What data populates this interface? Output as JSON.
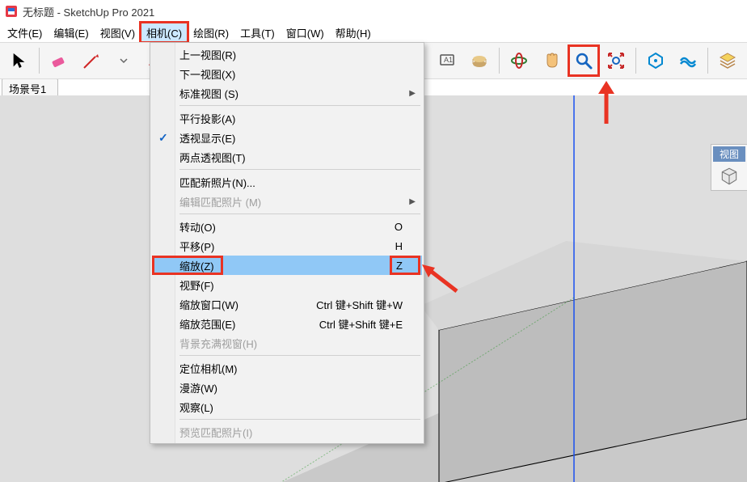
{
  "title": "无标题 - SketchUp Pro 2021",
  "menubar": {
    "file": "文件(E)",
    "edit": "编辑(E)",
    "view": "视图(V)",
    "camera": "相机(C)",
    "draw": "绘图(R)",
    "tools": "工具(T)",
    "window": "窗口(W)",
    "help": "帮助(H)"
  },
  "scene_tab": "场景号1",
  "camera_menu": {
    "prev_view": {
      "label": "上一视图(R)"
    },
    "next_view": {
      "label": "下一视图(X)"
    },
    "standard_views": {
      "label": "标准视图 (S)",
      "submenu": true
    },
    "parallel": {
      "label": "平行投影(A)"
    },
    "perspective": {
      "label": "透视显示(E)",
      "checked": true
    },
    "two_point": {
      "label": "两点透视图(T)"
    },
    "match_new_photo": {
      "label": "匹配新照片(N)..."
    },
    "edit_match_photo": {
      "label": "编辑匹配照片 (M)",
      "submenu": true,
      "disabled": true
    },
    "orbit": {
      "label": "转动(O)",
      "shortcut": "O"
    },
    "pan": {
      "label": "平移(P)",
      "shortcut": "H"
    },
    "zoom": {
      "label": "缩放(Z)",
      "shortcut": "Z",
      "selected": true
    },
    "fov": {
      "label": "视野(F)"
    },
    "zoom_window": {
      "label": "缩放窗口(W)",
      "shortcut": "Ctrl 键+Shift 键+W"
    },
    "zoom_extents": {
      "label": "缩放范围(E)",
      "shortcut": "Ctrl 键+Shift 键+E"
    },
    "bg_zoom": {
      "label": "背景充满视窗(H)",
      "disabled": true
    },
    "position_camera": {
      "label": "定位相机(M)"
    },
    "walk": {
      "label": "漫游(W)"
    },
    "look": {
      "label": "观察(L)"
    },
    "preview_match": {
      "label": "预览匹配照片(I)",
      "disabled": true
    }
  },
  "side_panel": {
    "title": "视图"
  }
}
